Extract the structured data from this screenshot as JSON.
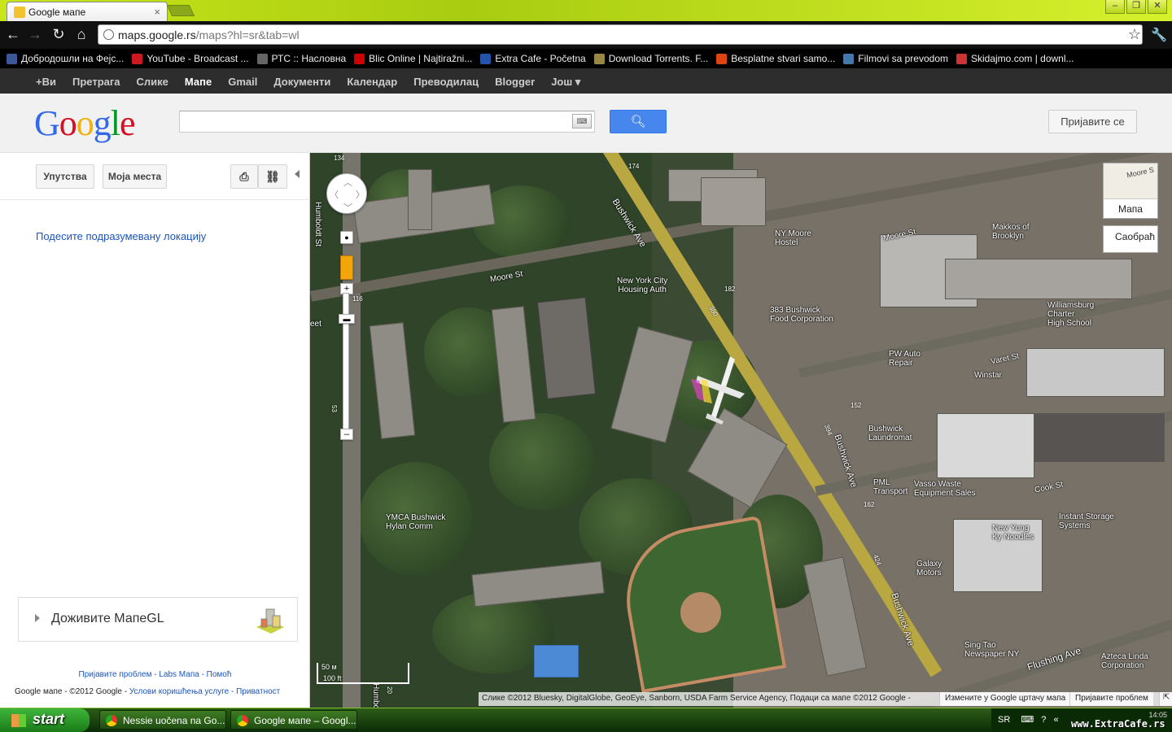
{
  "browser": {
    "tab_title": "Google мапе",
    "url_host": "maps.google.rs",
    "url_path": "/maps?hl=sr&tab=wl",
    "bookmarks": [
      {
        "label": "Добродошли на Фејс...",
        "color": "#3b5998"
      },
      {
        "label": "YouTube - Broadcast ...",
        "color": "#cc181e"
      },
      {
        "label": "РТС :: Насловна",
        "color": "#666"
      },
      {
        "label": "Blic Online | Najtiražni...",
        "color": "#c00"
      },
      {
        "label": "Extra Cafe - Početna",
        "color": "#2255aa"
      },
      {
        "label": "Download Torrents. F...",
        "color": "#998844"
      },
      {
        "label": "Besplatne stvari samo...",
        "color": "#dd4411"
      },
      {
        "label": "Filmovi sa prevodom",
        "color": "#4477aa"
      },
      {
        "label": "Skidajmo.com | downl...",
        "color": "#cc3333"
      }
    ]
  },
  "gbar": {
    "items": [
      "+Ви",
      "Претрага",
      "Слике",
      "Мапе",
      "Gmail",
      "Документи",
      "Календар",
      "Преводилац",
      "Blogger",
      "Још ▾"
    ],
    "active": "Мапе"
  },
  "header": {
    "logo": "Google",
    "search_value": "",
    "search_icon": "magnifier-icon",
    "signin": "Пријавите се"
  },
  "panel": {
    "directions": "Упутства",
    "my_places": "Моја места",
    "set_location": "Подесите подразумевану локацију",
    "mapgl": "Доживите МапеGL",
    "footer_links": "Пријавите проблем - Labs Мапа - Помоћ",
    "footer_copy": "Google мапе - ©2012 Google -",
    "footer_terms": "Услови коришћења услуге - Приватност"
  },
  "map": {
    "map_type": "Мапа",
    "map_thumb": "Moore S",
    "traffic": "Саобраћ",
    "scale_m": "50 м",
    "scale_ft": "100 ft",
    "attribution": "Слике ©2012 Bluesky, DigitalGlobe, GeoEye, Sanborn, USDA Farm Service Agency, Подаци са мапе ©2012 Google -",
    "edit_link": "Измените у Google цртачу мапа",
    "report": "Пријавите проблем",
    "labels": {
      "bushwick_ave_top": "Bushwick Ave",
      "moore_st_left": "Moore St",
      "moore_st_right": "Moore St",
      "humboldt_st": "Humboldt St",
      "humboldt_bottom": "Humbolt",
      "nycha": "New York City\nHousing Auth",
      "food_corp": "383 Bushwick\nFood Corporation",
      "ny_moore": "NY Moore\nHostel",
      "makkos": "Makkos of\nBrooklyn",
      "williamsburg": "Williamsburg\nCharter\nHigh School",
      "pw_auto": "PW Auto\nRepair",
      "winstar": "Winstar",
      "varet_st": "Varet St",
      "bushwick_laundromat": "Bushwick\nLaundromat",
      "bushwick_ave_mid": "Bushwick Ave",
      "pml": "PML\nTransport",
      "vasso": "Vasso Waste\nEquipment Sales",
      "cook_st": "Cook St",
      "instant_storage": "Instant Storage\nSystems",
      "new_yung": "New Yung\nKy Noodles",
      "ymca": "YMCA Bushwick\nHylan Comm",
      "galaxy": "Galaxy\nMotors",
      "bushwick_ave_low": "Bushwick Ave",
      "sing_tao": "Sing Tao\nNewspaper NY",
      "flushing_ave": "Flushing Ave",
      "azteca": "Azteca Linda\nCorporation",
      "eet": "eet",
      "r174": "174",
      "r134": "134",
      "r116": "116",
      "r182": "182",
      "r380": "380",
      "r394": "394",
      "r152": "152",
      "r162": "162",
      "r424": "424",
      "r53": "53",
      "r20": "20"
    }
  },
  "taskbar": {
    "start": "start",
    "tasks": [
      "Nessie uočena na Go...",
      "Google мапе – Googl..."
    ],
    "lang": "SR",
    "clock": "14:05",
    "watermark": "www.ExtraCafe.rs"
  }
}
